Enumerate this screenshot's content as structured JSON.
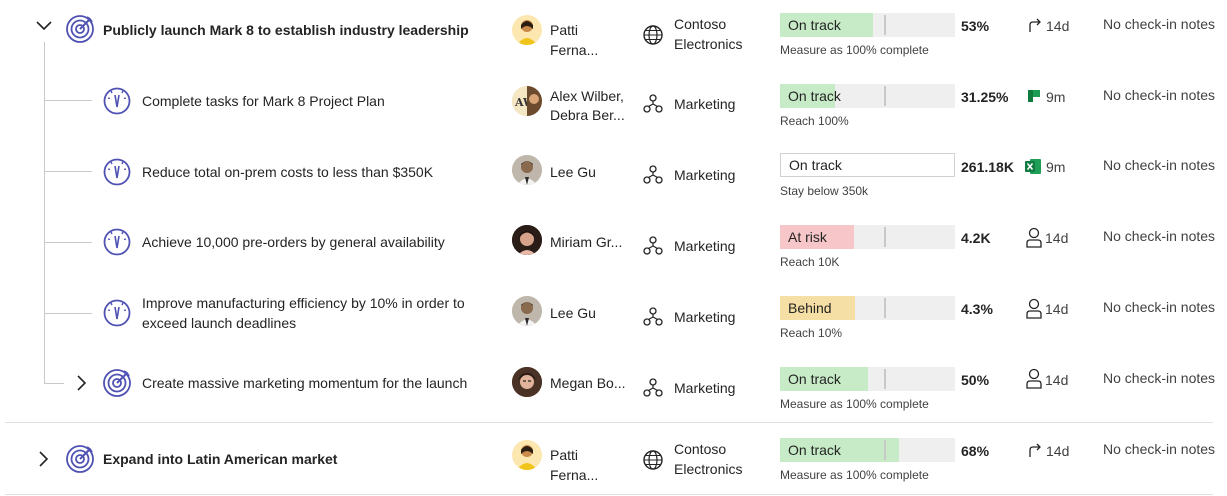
{
  "colors": {
    "on_track": "#c7ebc7",
    "at_risk": "#f7c6c9",
    "behind": "#f6dfa4",
    "goal_icon": "#4f52b2",
    "excel": "#107c41",
    "planner": "#0f7b3f"
  },
  "rows": [
    {
      "title": "Publicly launch Mark 8 to establish industry leadership",
      "owner": "Patti Ferna...",
      "team": [
        "Contoso",
        "Electronics"
      ],
      "status": "On track",
      "progress_pct": 53,
      "target_text": "Measure as 100% complete",
      "value": "53%",
      "checkin": "14d",
      "checkin_icon": "share-arrow-icon",
      "notes": "No check-in notes"
    },
    {
      "title": "Complete tasks for Mark 8 Project Plan",
      "owner": [
        "Alex Wilber,",
        "Debra Ber..."
      ],
      "team": "Marketing",
      "status": "On track",
      "progress_pct": 31.25,
      "target_text": "Reach 100%",
      "value": "31.25%",
      "checkin": "9m",
      "checkin_icon": "planner-icon",
      "notes": "No check-in notes"
    },
    {
      "title": "Reduce total on-prem costs to less than $350K",
      "owner": "Lee Gu",
      "team": "Marketing",
      "status": "On track",
      "progress_pct": 0,
      "target_text": "Stay below 350k",
      "value": "261.18K",
      "checkin": "9m",
      "checkin_icon": "excel-icon",
      "notes": "No check-in notes"
    },
    {
      "title": "Achieve 10,000 pre-orders by general availability",
      "owner": "Miriam Gr...",
      "team": "Marketing",
      "status": "At risk",
      "progress_pct": 42,
      "target_text": "Reach 10K",
      "value": "4.2K",
      "checkin": "14d",
      "checkin_icon": "person-icon",
      "notes": "No check-in notes"
    },
    {
      "title": [
        "Improve manufacturing efficiency by 10% in order to",
        "exceed launch deadlines"
      ],
      "owner": "Lee Gu",
      "team": "Marketing",
      "status": "Behind",
      "progress_pct": 43,
      "target_text": "Reach 10%",
      "value": "4.3%",
      "checkin": "14d",
      "checkin_icon": "person-icon",
      "notes": "No check-in notes"
    },
    {
      "title": "Create massive marketing momentum for the launch",
      "owner": "Megan Bo...",
      "team": "Marketing",
      "status": "On track",
      "progress_pct": 50,
      "target_text": "Measure as 100% complete",
      "value": "50%",
      "checkin": "14d",
      "checkin_icon": "person-icon",
      "notes": "No check-in notes"
    },
    {
      "title": "Expand into Latin American market",
      "owner": "Patti Ferna...",
      "team": [
        "Contoso",
        "Electronics"
      ],
      "status": "On track",
      "progress_pct": 68,
      "target_text": "Measure as 100% complete",
      "value": "68%",
      "checkin": "14d",
      "checkin_icon": "share-arrow-icon",
      "notes": "No check-in notes"
    }
  ]
}
